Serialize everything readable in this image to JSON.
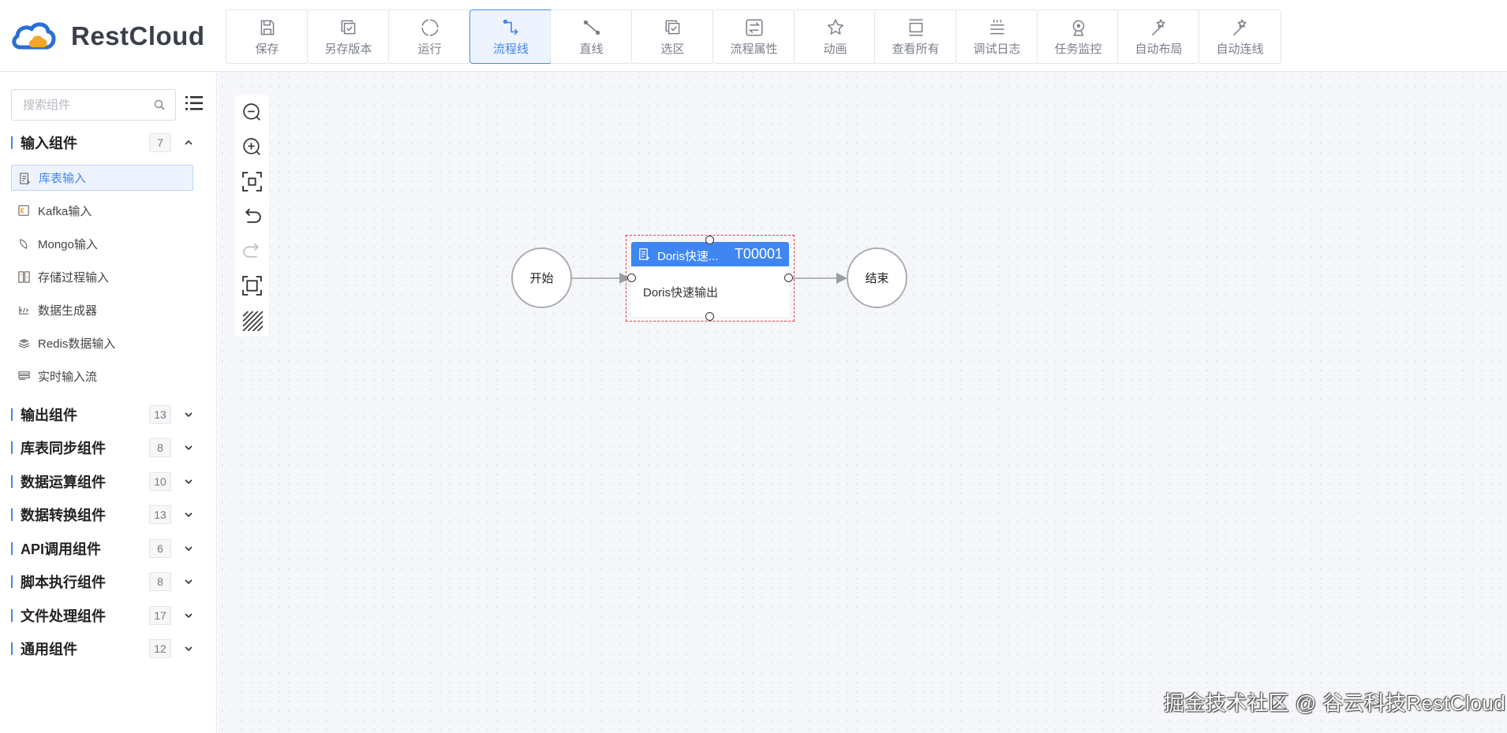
{
  "app": {
    "name": "RestCloud"
  },
  "toolbar": [
    {
      "id": "save",
      "label": "保存",
      "icon": "save-icon"
    },
    {
      "id": "save-version",
      "label": "另存版本",
      "icon": "copy-check-icon"
    },
    {
      "id": "run",
      "label": "运行",
      "icon": "loading-icon"
    },
    {
      "id": "flow-line",
      "label": "流程线",
      "icon": "flow-line-icon",
      "active": true
    },
    {
      "id": "straight-line",
      "label": "直线",
      "icon": "straight-line-icon"
    },
    {
      "id": "select-area",
      "label": "选区",
      "icon": "select-area-icon"
    },
    {
      "id": "flow-props",
      "label": "流程属性",
      "icon": "swap-icon"
    },
    {
      "id": "animation",
      "label": "动画",
      "icon": "star-icon"
    },
    {
      "id": "view-all",
      "label": "查看所有",
      "icon": "view-all-icon"
    },
    {
      "id": "debug-log",
      "label": "调试日志",
      "icon": "log-icon"
    },
    {
      "id": "task-monitor",
      "label": "任务监控",
      "icon": "monitor-icon"
    },
    {
      "id": "auto-layout",
      "label": "自动布局",
      "icon": "magic-wand-icon"
    },
    {
      "id": "auto-connect",
      "label": "自动连线",
      "icon": "magic-wand-icon"
    }
  ],
  "sidebar": {
    "search_placeholder": "搜索组件",
    "groups": [
      {
        "name": "输入组件",
        "count": "7",
        "expanded": true,
        "items": [
          {
            "name": "库表输入",
            "icon": "table-input-icon",
            "selected": true
          },
          {
            "name": "Kafka输入",
            "icon": "kafka-icon"
          },
          {
            "name": "Mongo输入",
            "icon": "mongo-icon"
          },
          {
            "name": "存储过程输入",
            "icon": "procedure-icon"
          },
          {
            "name": "数据生成器",
            "icon": "code-icon"
          },
          {
            "name": "Redis数据输入",
            "icon": "redis-icon"
          },
          {
            "name": "实时输入流",
            "icon": "stream-icon"
          }
        ]
      },
      {
        "name": "输出组件",
        "count": "13"
      },
      {
        "name": "库表同步组件",
        "count": "8"
      },
      {
        "name": "数据运算组件",
        "count": "10"
      },
      {
        "name": "数据转换组件",
        "count": "13"
      },
      {
        "name": "API调用组件",
        "count": "6"
      },
      {
        "name": "脚本执行组件",
        "count": "8"
      },
      {
        "name": "文件处理组件",
        "count": "17"
      },
      {
        "name": "通用组件",
        "count": "12"
      }
    ]
  },
  "canvas_tools": [
    {
      "name": "zoom-out",
      "icon": "zoom-out-icon"
    },
    {
      "name": "zoom-in",
      "icon": "zoom-in-icon"
    },
    {
      "name": "fit-view",
      "icon": "fit-view-icon"
    },
    {
      "name": "undo",
      "icon": "undo-icon"
    },
    {
      "name": "redo",
      "icon": "redo-icon",
      "disabled": true
    },
    {
      "name": "full-screen",
      "icon": "full-screen-icon"
    },
    {
      "name": "grid",
      "icon": "grid-pattern-icon"
    }
  ],
  "flow": {
    "start_label": "开始",
    "end_label": "结束",
    "task": {
      "title": "Doris快速...",
      "id": "T00001",
      "body": "Doris快速输出",
      "header_color": "#3f86f2"
    }
  },
  "watermark": "掘金技术社区 @ 谷云科技RestCloud",
  "colors": {
    "accent": "#3f86f2",
    "selection": "#ea3a3a"
  }
}
